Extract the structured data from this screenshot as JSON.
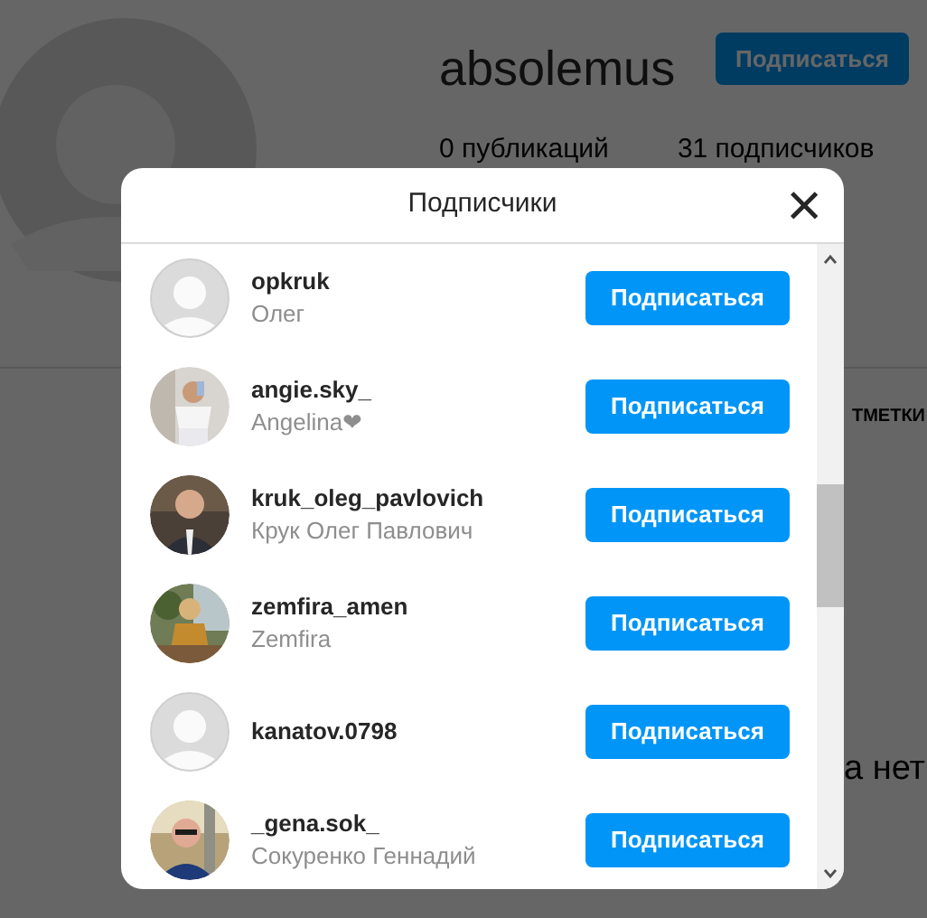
{
  "profile": {
    "username": "absolemus",
    "follow_button": "Подписаться",
    "stats": [
      "0 публикаций",
      "31 подписчиков"
    ],
    "tab_fragment": "ТМЕТКИ",
    "empty_fragment": "а нет"
  },
  "dialog": {
    "title": "Подписчики",
    "close": "×",
    "followers": [
      {
        "username": "opkruk",
        "name": "Олег",
        "kind": "default",
        "button": "Подписаться"
      },
      {
        "username": "angie.sky_",
        "name": "Angelina❤",
        "kind": "picture",
        "button": "Подписаться"
      },
      {
        "username": "kruk_oleg_pavlovich",
        "name": "Крук Олег Павлович",
        "kind": "picture",
        "button": "Подписаться"
      },
      {
        "username": "zemfira_amen",
        "name": "Zemfira",
        "kind": "picture",
        "button": "Подписаться"
      },
      {
        "username": "kanatov.0798",
        "kind": "default",
        "button": "Подписаться"
      },
      {
        "username": "_gena.sok_",
        "name": "Сокуренко Геннадий",
        "kind": "picture",
        "button": "Подписаться"
      }
    ]
  }
}
